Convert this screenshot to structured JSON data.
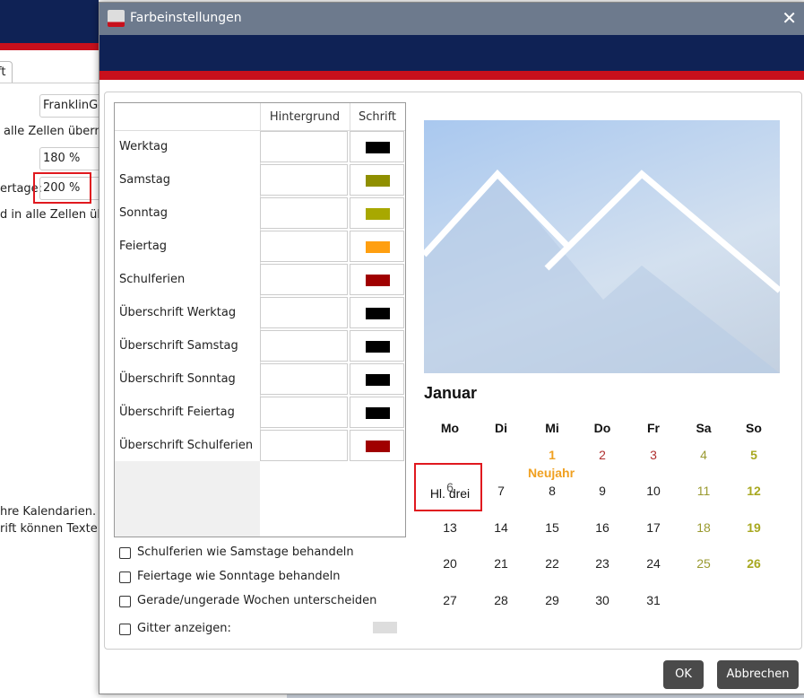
{
  "background": {
    "tab_label": "ft",
    "font_value": "FranklinGo",
    "apply_text_1": "alle Zellen übernc",
    "size_1": "180 %",
    "holiday_label": "ertage:",
    "size_2": "200 %",
    "apply_text_2": "d in alle Zellen übe",
    "info_1": "hre Kalendarien.",
    "info_2": "rift können Texte a"
  },
  "dialog": {
    "title": "Farbeinstellungen",
    "close": "✕"
  },
  "table": {
    "headers": [
      "",
      "Hintergrund",
      "Schrift"
    ],
    "rows": [
      {
        "label": "Werktag",
        "font_color": "#000000"
      },
      {
        "label": "Samstag",
        "font_color": "#8f8f00"
      },
      {
        "label": "Sonntag",
        "font_color": "#a8a800"
      },
      {
        "label": "Feiertag",
        "font_color": "#ff9f10"
      },
      {
        "label": "Schulferien",
        "font_color": "#a00000"
      },
      {
        "label": "Überschrift Werktag",
        "font_color": "#000000"
      },
      {
        "label": "Überschrift Samstag",
        "font_color": "#000000"
      },
      {
        "label": "Überschrift Sonntag",
        "font_color": "#000000"
      },
      {
        "label": "Überschrift Feiertag",
        "font_color": "#000000"
      },
      {
        "label": "Überschrift Schulferien",
        "font_color": "#a00000"
      }
    ]
  },
  "options": [
    {
      "label": "Schulferien wie Samstage behandeln",
      "checked": false
    },
    {
      "label": "Feiertage wie Sonntage behandeln",
      "checked": false
    },
    {
      "label": "Gerade/ungerade Wochen unterscheiden",
      "checked": false
    },
    {
      "label": "Gitter anzeigen:",
      "checked": false,
      "color": "#dddddd"
    }
  ],
  "preview": {
    "month": "Januar",
    "weekdays": [
      "Mo",
      "Di",
      "Mi",
      "Do",
      "Fr",
      "Sa",
      "So"
    ],
    "weeks": [
      [
        "",
        "",
        "1",
        "2",
        "3",
        "4",
        "5"
      ],
      [
        "6",
        "7",
        "8",
        "9",
        "10",
        "11",
        "12"
      ],
      [
        "13",
        "14",
        "15",
        "16",
        "17",
        "18",
        "19"
      ],
      [
        "20",
        "21",
        "22",
        "23",
        "24",
        "25",
        "26"
      ],
      [
        "27",
        "28",
        "29",
        "30",
        "31",
        "",
        ""
      ]
    ],
    "holiday_labels": {
      "neujahr": "Neujahr",
      "hl_drei": "Hl. drei"
    },
    "colors": {
      "holiday": "#f0a020",
      "schulferien": "#b03030",
      "saturday": "#9a9a30",
      "sunday": "#a8a820"
    }
  },
  "buttons": {
    "ok": "OK",
    "cancel": "Abbrechen"
  }
}
